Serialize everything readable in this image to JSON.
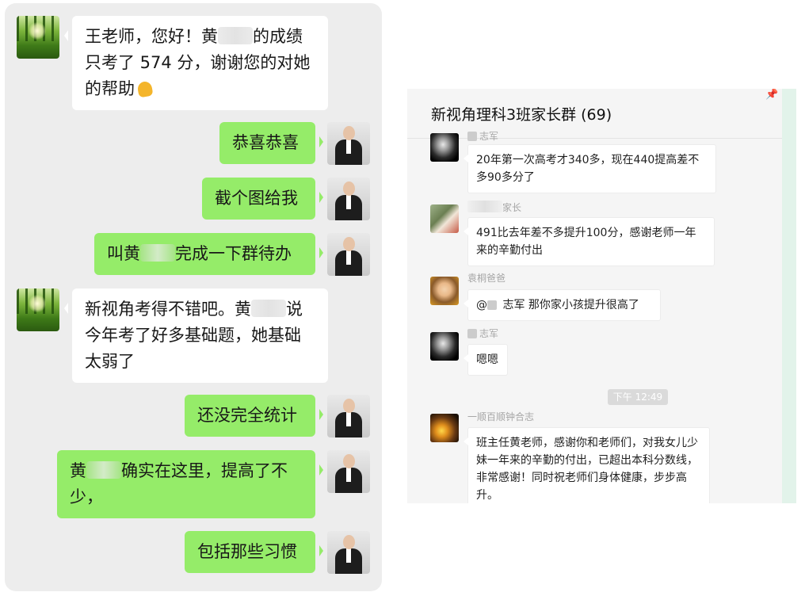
{
  "private_chat": {
    "messages": [
      {
        "side": "in",
        "part1": "王老师，您好！黄",
        "part2": "的成绩只考了 574 分，谢谢您的对她的帮助"
      },
      {
        "side": "out",
        "text": "恭喜恭喜"
      },
      {
        "side": "out",
        "text": "截个图给我"
      },
      {
        "side": "out",
        "part1": "叫黄",
        "part2": "完成一下群待办"
      },
      {
        "side": "in",
        "part1": "新视角考得不错吧。黄",
        "part2": "说今年考了好多基础题，她基础太弱了"
      },
      {
        "side": "out",
        "text": "还没完全统计"
      },
      {
        "side": "out",
        "part1": "黄",
        "part2": "确实在这里，提高了不少，"
      },
      {
        "side": "out",
        "text": "包括那些习惯"
      }
    ]
  },
  "group_chat": {
    "title": "新视角理科3班家长群 (69)",
    "timestamp": "下午 12:49",
    "messages": [
      {
        "sender": "志军",
        "text": "20年第一次高考才340多，现在440提高差不多90多分了"
      },
      {
        "sender": "家长",
        "text": "491比去年差不多提升100分，感谢老师一年来的辛勤付出"
      },
      {
        "sender": "袁桐爸爸",
        "mention": "@",
        "text": "志军 那你家小孩提升很高了"
      },
      {
        "sender": "志军",
        "text": "嗯嗯"
      },
      {
        "sender": "一顺百顺钟合志",
        "text": "班主任黄老师，感谢你和老师们，对我女儿少妹一年来的辛勤的付出，已超出本科分数线，非常感谢！同时祝老师们身体健康，步步高升。"
      }
    ]
  }
}
